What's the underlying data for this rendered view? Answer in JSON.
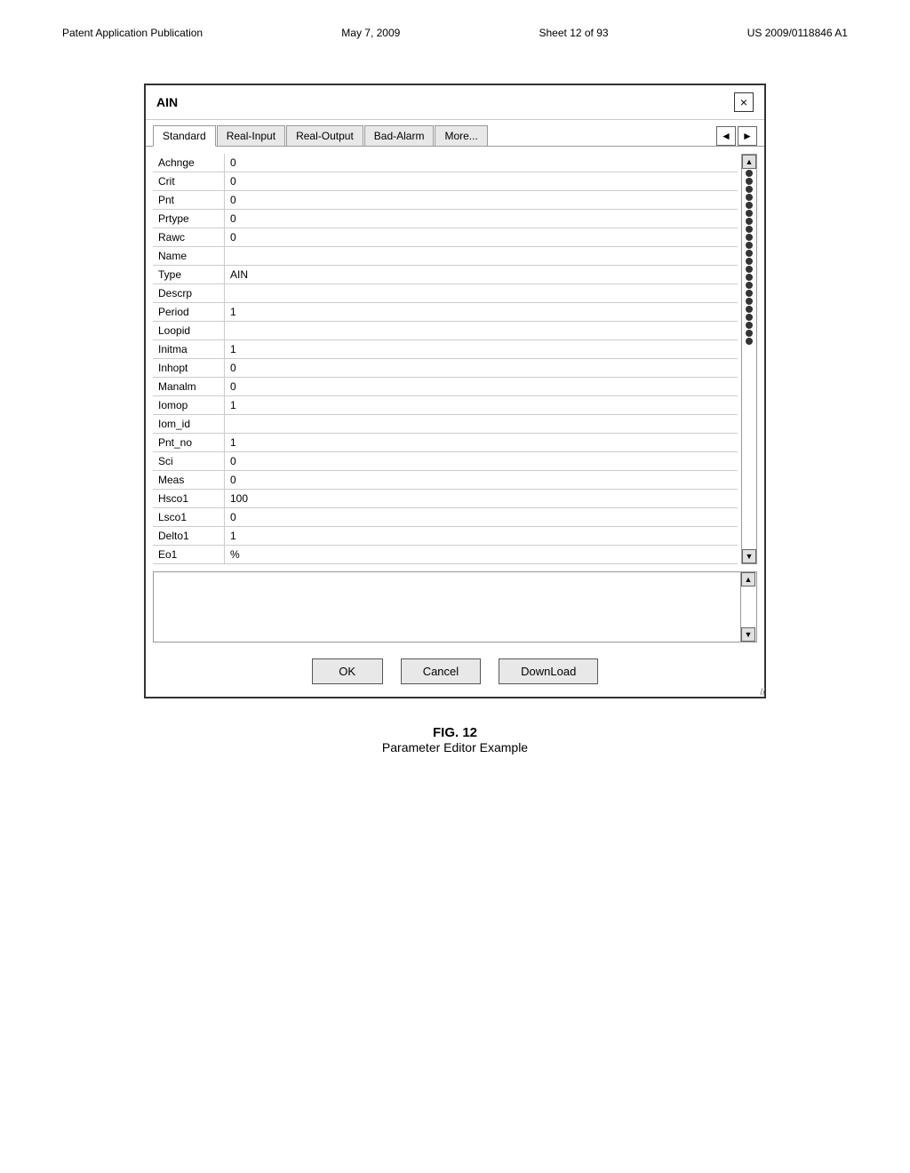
{
  "patent": {
    "left_label": "Patent Application Publication",
    "date": "May 7, 2009",
    "sheet": "Sheet 12 of 93",
    "number": "US 2009/0118846 A1"
  },
  "dialog": {
    "title": "AIN",
    "close_label": "×",
    "tabs": [
      {
        "label": "Standard",
        "active": true
      },
      {
        "label": "Real-Input",
        "active": false
      },
      {
        "label": "Real-Output",
        "active": false
      },
      {
        "label": "Bad-Alarm",
        "active": false
      },
      {
        "label": "More...",
        "active": false
      }
    ],
    "nav_prev": "◄",
    "nav_next": "►",
    "params": [
      {
        "label": "Achnge",
        "value": "0"
      },
      {
        "label": "Crit",
        "value": "0"
      },
      {
        "label": "Pnt",
        "value": "0"
      },
      {
        "label": "Prtype",
        "value": "0"
      },
      {
        "label": "Rawc",
        "value": "0"
      },
      {
        "label": "Name",
        "value": ""
      },
      {
        "label": "Type",
        "value": "AIN"
      },
      {
        "label": "Descrp",
        "value": ""
      },
      {
        "label": "Period",
        "value": "1"
      },
      {
        "label": "Loopid",
        "value": ""
      },
      {
        "label": "Initma",
        "value": "1"
      },
      {
        "label": "Inhopt",
        "value": "0"
      },
      {
        "label": "Manalm",
        "value": "0"
      },
      {
        "label": "Iomop",
        "value": "1"
      },
      {
        "label": "Iom_id",
        "value": ""
      },
      {
        "label": "Pnt_no",
        "value": "1"
      },
      {
        "label": "Sci",
        "value": "0"
      },
      {
        "label": "Meas",
        "value": "0"
      },
      {
        "label": "Hsco1",
        "value": "100"
      },
      {
        "label": "Lsco1",
        "value": "0"
      },
      {
        "label": "Delto1",
        "value": "1"
      },
      {
        "label": "Eo1",
        "value": "%"
      }
    ],
    "scroll_up": "▲",
    "scroll_down": "▼",
    "buttons": {
      "ok": "OK",
      "cancel": "Cancel",
      "download": "DownLoad"
    }
  },
  "figure": {
    "label": "FIG. 12",
    "caption": "Parameter Editor Example"
  }
}
